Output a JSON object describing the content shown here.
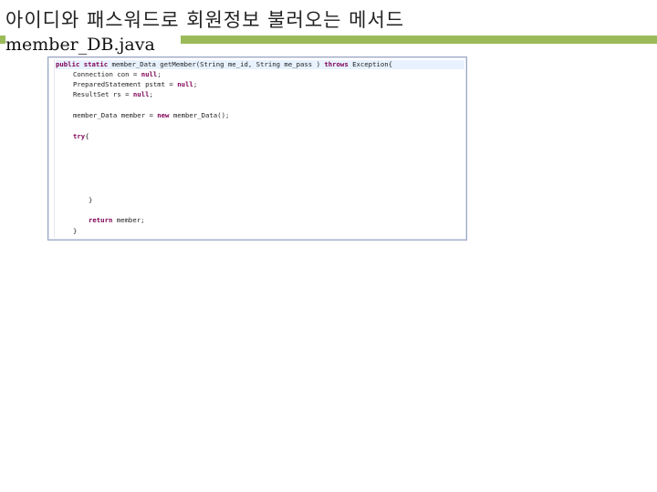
{
  "slide": {
    "title": "아이디와 패스워드로 회원정보 불러오는 메서드",
    "subtitle": "member_DB.java"
  },
  "code": {
    "lines": [
      {
        "indent": 0,
        "kw1": "public static",
        "txt": " member_Data getMember(String me_id, String me_pass ) ",
        "kw2": "throws",
        "txt2": " Exception{",
        "active": true
      },
      {
        "indent": 1,
        "kw1": "",
        "txt": "Connection con = ",
        "kw2": "null",
        "txt2": ";"
      },
      {
        "indent": 1,
        "kw1": "",
        "txt": "PreparedStatement pstmt = ",
        "kw2": "null",
        "txt2": ";"
      },
      {
        "indent": 1,
        "kw1": "",
        "txt": "ResultSet rs = ",
        "kw2": "null",
        "txt2": ";"
      },
      {
        "indent": 1,
        "kw1": "",
        "txt": "member_Data member = ",
        "kw2": "new",
        "txt2": " member_Data();"
      },
      {
        "indent": 1,
        "kw1": "try",
        "txt": "{",
        "kw2": "",
        "txt2": ""
      },
      {
        "indent": 2,
        "kw1": "",
        "txt": "}",
        "kw2": "",
        "txt2": ""
      },
      {
        "indent": 2,
        "kw1": "return",
        "txt": " member;",
        "kw2": "",
        "txt2": ""
      },
      {
        "indent": 1,
        "kw1": "",
        "txt": "}",
        "kw2": "",
        "txt2": ""
      }
    ]
  }
}
